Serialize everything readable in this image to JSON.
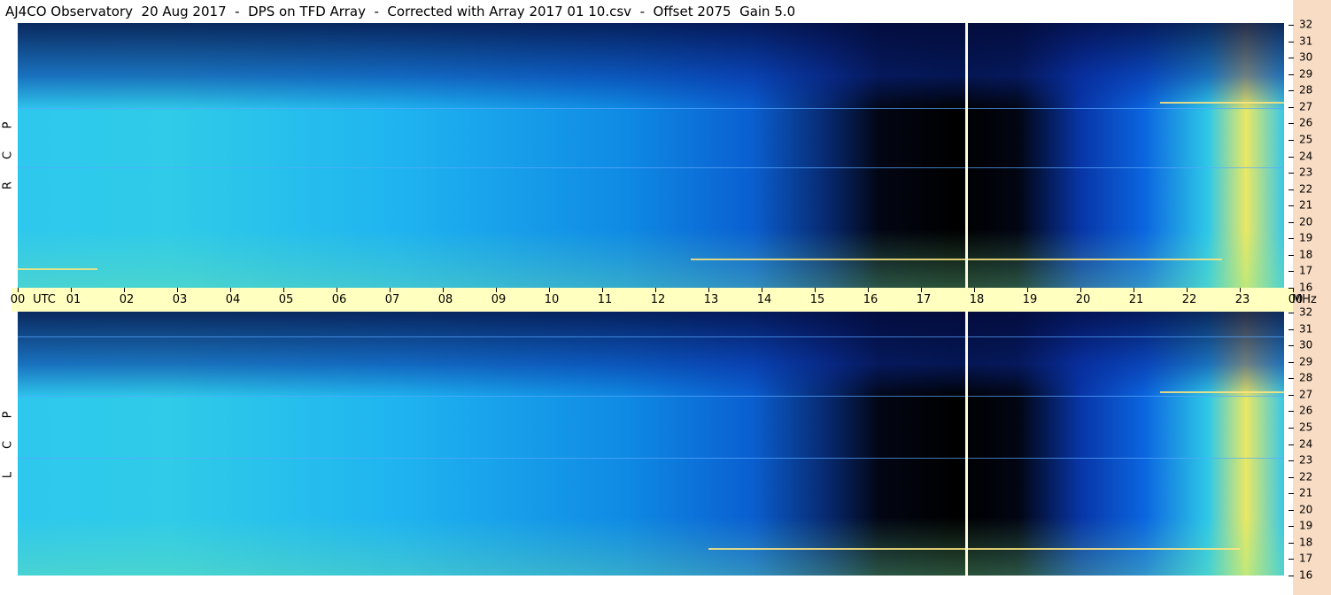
{
  "title": "AJ4CO Observatory  20 Aug 2017  -  DPS on TFD Array  -  Corrected with Array 2017 01 10.csv  -  Offset 2075  Gain 5.0",
  "colors": {
    "time_axis_bg": "#ffffc0",
    "freq_axis_bg": "#f8dcc4",
    "spectrogram_low": "#000000",
    "spectrogram_mid": "#0a5fd0",
    "spectrogram_high": "#e9e864"
  },
  "chart_data": {
    "type": "heatmap",
    "title": "AJ4CO Observatory  20 Aug 2017  -  DPS on TFD Array  -  Corrected with Array 2017 01 10.csv  -  Offset 2075  Gain 5.0",
    "x_axis": {
      "unit_label": "UTC",
      "ticks": [
        "00",
        "01",
        "02",
        "03",
        "04",
        "05",
        "06",
        "07",
        "08",
        "09",
        "10",
        "11",
        "12",
        "13",
        "14",
        "15",
        "16",
        "17",
        "18",
        "19",
        "20",
        "21",
        "22",
        "23",
        "00"
      ],
      "range_hours": [
        0,
        24
      ]
    },
    "y_axis": {
      "unit_label": "MHz",
      "ticks": [
        "16",
        "17",
        "18",
        "19",
        "20",
        "21",
        "22",
        "23",
        "24",
        "25",
        "26",
        "27",
        "28",
        "29",
        "30",
        "31",
        "32"
      ],
      "range": [
        16,
        32
      ]
    },
    "panels": [
      {
        "polarization_label": [
          "R",
          "C",
          "P"
        ]
      },
      {
        "polarization_label": [
          "L",
          "C",
          "P"
        ]
      }
    ],
    "colorscale": [
      "#000000",
      "#07286e",
      "#0a5fd0",
      "#1fb4f0",
      "#2ec8ee",
      "#e9e864"
    ],
    "marker_line_utc_hour": 17.8
  }
}
